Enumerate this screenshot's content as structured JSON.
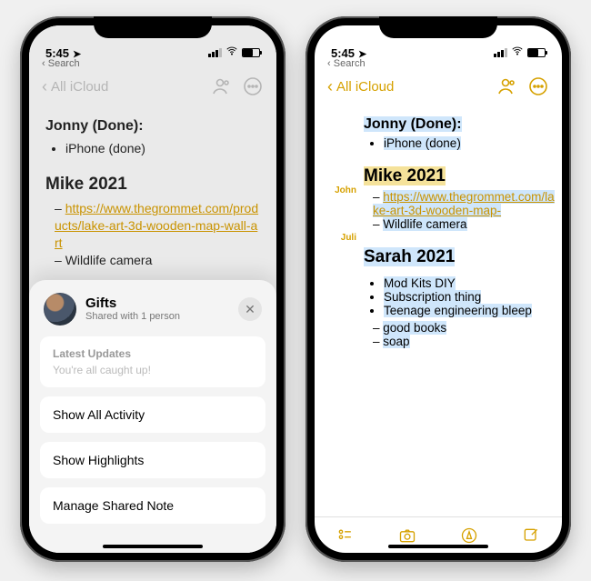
{
  "status": {
    "time": "5:45",
    "back": "Search"
  },
  "nav": {
    "back_label": "All iCloud"
  },
  "note": {
    "h1": "Jonny (Done):",
    "h1_item": "iPhone (done)",
    "h2a": "Mike 2021",
    "h2a_link": "https://www.thegrommet.com/products/lake-art-3d-wooden-map-wall-art",
    "h2a_link_r": "https://www.thegrommet.com/lake-art-3d-wooden-map-",
    "h2a_item": "Wildlife camera",
    "h2b": "Sarah 2021",
    "h2b_cut": "Mod Kits DIY",
    "sarah_items": [
      "Mod Kits DIY",
      "Subscription thing",
      "Teenage engineering bleep",
      "good books",
      "soap"
    ]
  },
  "sheet": {
    "title": "Gifts",
    "subtitle": "Shared with 1 person",
    "updates_head": "Latest Updates",
    "updates_body": "You're all caught up!",
    "row1": "Show All Activity",
    "row2": "Show Highlights",
    "row3": "Manage Shared Note"
  },
  "attrib": {
    "a": "John",
    "b": "Juli"
  }
}
